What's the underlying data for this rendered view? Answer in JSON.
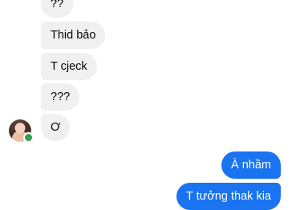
{
  "conversation": {
    "incoming": [
      {
        "text": "??"
      },
      {
        "text": "Thid bảo"
      },
      {
        "text": "T cjeck"
      },
      {
        "text": "???"
      },
      {
        "text": "Ơ"
      }
    ],
    "outgoing": [
      {
        "text": "À nhầm"
      },
      {
        "text": "T tưởng thak kia"
      }
    ]
  },
  "colors": {
    "incoming_bubble": "#f1f0f0",
    "outgoing_bubble": "#1a73f0",
    "online_indicator": "#31a24c"
  }
}
